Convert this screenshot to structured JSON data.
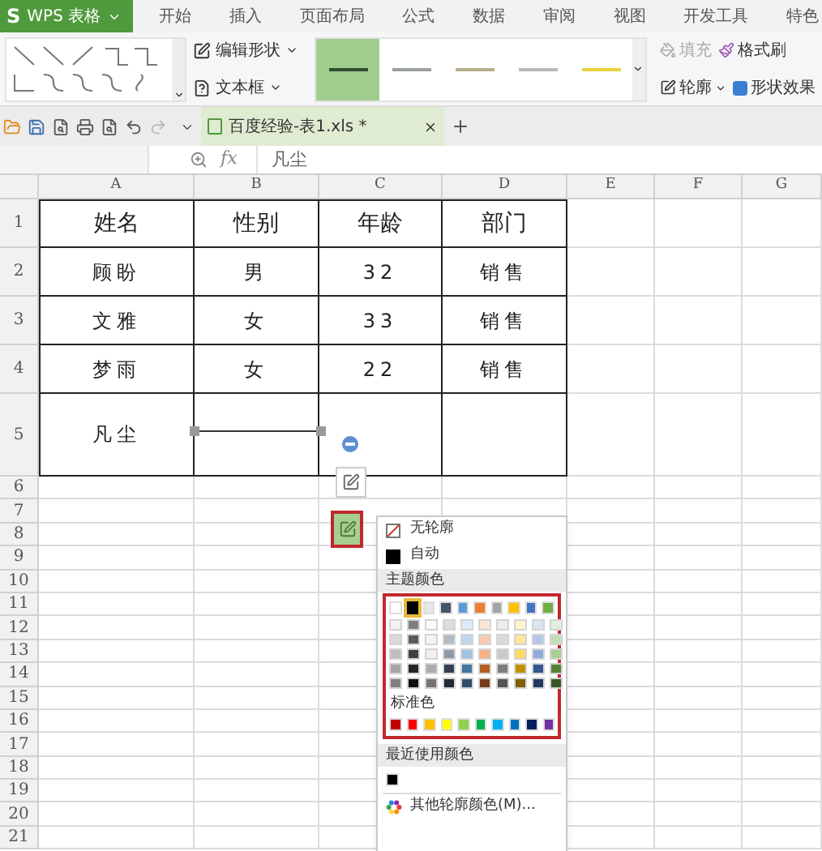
{
  "app": {
    "logo_mark": "S",
    "logo": "WPS 表格"
  },
  "menu_tabs": [
    "开始",
    "插入",
    "页面布局",
    "公式",
    "数据",
    "审阅",
    "视图",
    "开发工具",
    "特色"
  ],
  "ribbon": {
    "edit_shape": "编辑形状",
    "text_box": "文本框",
    "line_styles": [
      {
        "selected": true,
        "color": "#2f4f2f"
      },
      {
        "selected": false,
        "color": "#9aa0a0"
      },
      {
        "selected": false,
        "color": "#b5b08a"
      },
      {
        "selected": false,
        "color": "#b9b9b9"
      },
      {
        "selected": false,
        "color": "#e8d23a"
      }
    ],
    "fill": {
      "label": "填充",
      "disabled": true
    },
    "format_painter": "格式刷",
    "outline": "轮廓",
    "shape_effects": "形状效果"
  },
  "document_tab": {
    "title": "百度经验-表1.xls *"
  },
  "formula_bar": {
    "fx": "fx",
    "value": "凡尘"
  },
  "sheet": {
    "columns": [
      "A",
      "B",
      "C",
      "D",
      "E",
      "F",
      "G"
    ],
    "row_numbers": [
      "1",
      "2",
      "3",
      "4",
      "5",
      "6",
      "7",
      "8",
      "9",
      "10",
      "11",
      "12",
      "13",
      "14",
      "15",
      "16",
      "17",
      "18",
      "19",
      "20",
      "21"
    ],
    "rows": [
      [
        "姓名",
        "性别",
        "年龄",
        "部门"
      ],
      [
        "顾盼",
        "男",
        "32",
        "销售"
      ],
      [
        "文雅",
        "女",
        "33",
        "销售"
      ],
      [
        "梦雨",
        "女",
        "22",
        "销售"
      ],
      [
        "凡尘"
      ]
    ]
  },
  "color_menu": {
    "items": [
      {
        "kind": "none",
        "label": "无轮廓"
      },
      {
        "kind": "auto",
        "label": "自动",
        "color": "#000000"
      }
    ],
    "theme_heading": "主题颜色",
    "theme_colors": [
      {
        "color": "#ffffff",
        "selected": false
      },
      {
        "color": "#000000",
        "selected": true
      },
      {
        "color": "#e7e6e6",
        "selected": false
      },
      {
        "color": "#44546a",
        "selected": false
      },
      {
        "color": "#5b9bd5",
        "selected": false
      },
      {
        "color": "#ed7d31",
        "selected": false
      },
      {
        "color": "#a5a5a5",
        "selected": false
      },
      {
        "color": "#ffc000",
        "selected": false
      },
      {
        "color": "#4472c4",
        "selected": false
      },
      {
        "color": "#70ad47",
        "selected": false
      }
    ],
    "standard_heading": "标准色",
    "standard_colors": [
      {
        "color": "#c00000"
      },
      {
        "color": "#ff0000"
      },
      {
        "color": "#ffc000"
      },
      {
        "color": "#ffff00"
      },
      {
        "color": "#92d050"
      },
      {
        "color": "#00b050"
      },
      {
        "color": "#00b0f0"
      },
      {
        "color": "#0070c0"
      },
      {
        "color": "#002060"
      },
      {
        "color": "#7030a0"
      }
    ],
    "recent_heading": "最近使用颜色",
    "recent_colors": [
      {
        "color": "#000000"
      }
    ],
    "more": "其他轮廓颜色(M)..."
  }
}
